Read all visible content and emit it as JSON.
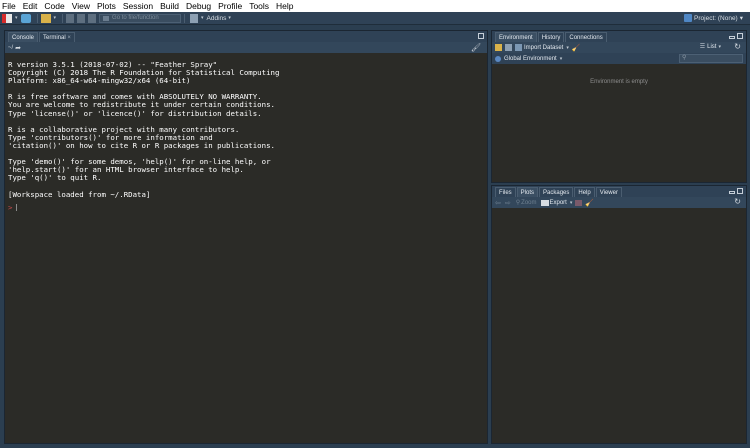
{
  "menu": [
    "File",
    "Edit",
    "Code",
    "View",
    "Plots",
    "Session",
    "Build",
    "Debug",
    "Profile",
    "Tools",
    "Help"
  ],
  "toolbar": {
    "goto_placeholder": "Go to file/function",
    "addins_label": "Addins",
    "project_label": "Project: (None)"
  },
  "console": {
    "tabs": [
      "Console",
      "Terminal"
    ],
    "path": "~/",
    "lines": [
      "R version 3.5.1 (2018-07-02) -- \"Feather Spray\"",
      "Copyright (C) 2018 The R Foundation for Statistical Computing",
      "Platform: x86_64-w64-mingw32/x64 (64-bit)",
      "",
      "R is free software and comes with ABSOLUTELY NO WARRANTY.",
      "You are welcome to redistribute it under certain conditions.",
      "Type 'license()' or 'licence()' for distribution details.",
      "",
      "R is a collaborative project with many contributors.",
      "Type 'contributors()' for more information and",
      "'citation()' on how to cite R or R packages in publications.",
      "",
      "Type 'demo()' for some demos, 'help()' for on-line help, or",
      "'help.start()' for an HTML browser interface to help.",
      "Type 'q()' to quit R.",
      "",
      "[Workspace loaded from ~/.RData]"
    ],
    "prompt": ">"
  },
  "environment": {
    "tabs": [
      "Environment",
      "History",
      "Connections"
    ],
    "import_label": "Import Dataset",
    "list_label": "List",
    "scope_label": "Global Environment",
    "empty_message": "Environment is empty"
  },
  "files": {
    "tabs": [
      "Files",
      "Plots",
      "Packages",
      "Help",
      "Viewer"
    ],
    "zoom_label": "Zoom",
    "export_label": "Export"
  },
  "colors": {
    "chrome": "#2f4256",
    "editor_bg": "#2b2b27",
    "prompt": "#c84b4b",
    "text": "#ffffff"
  }
}
